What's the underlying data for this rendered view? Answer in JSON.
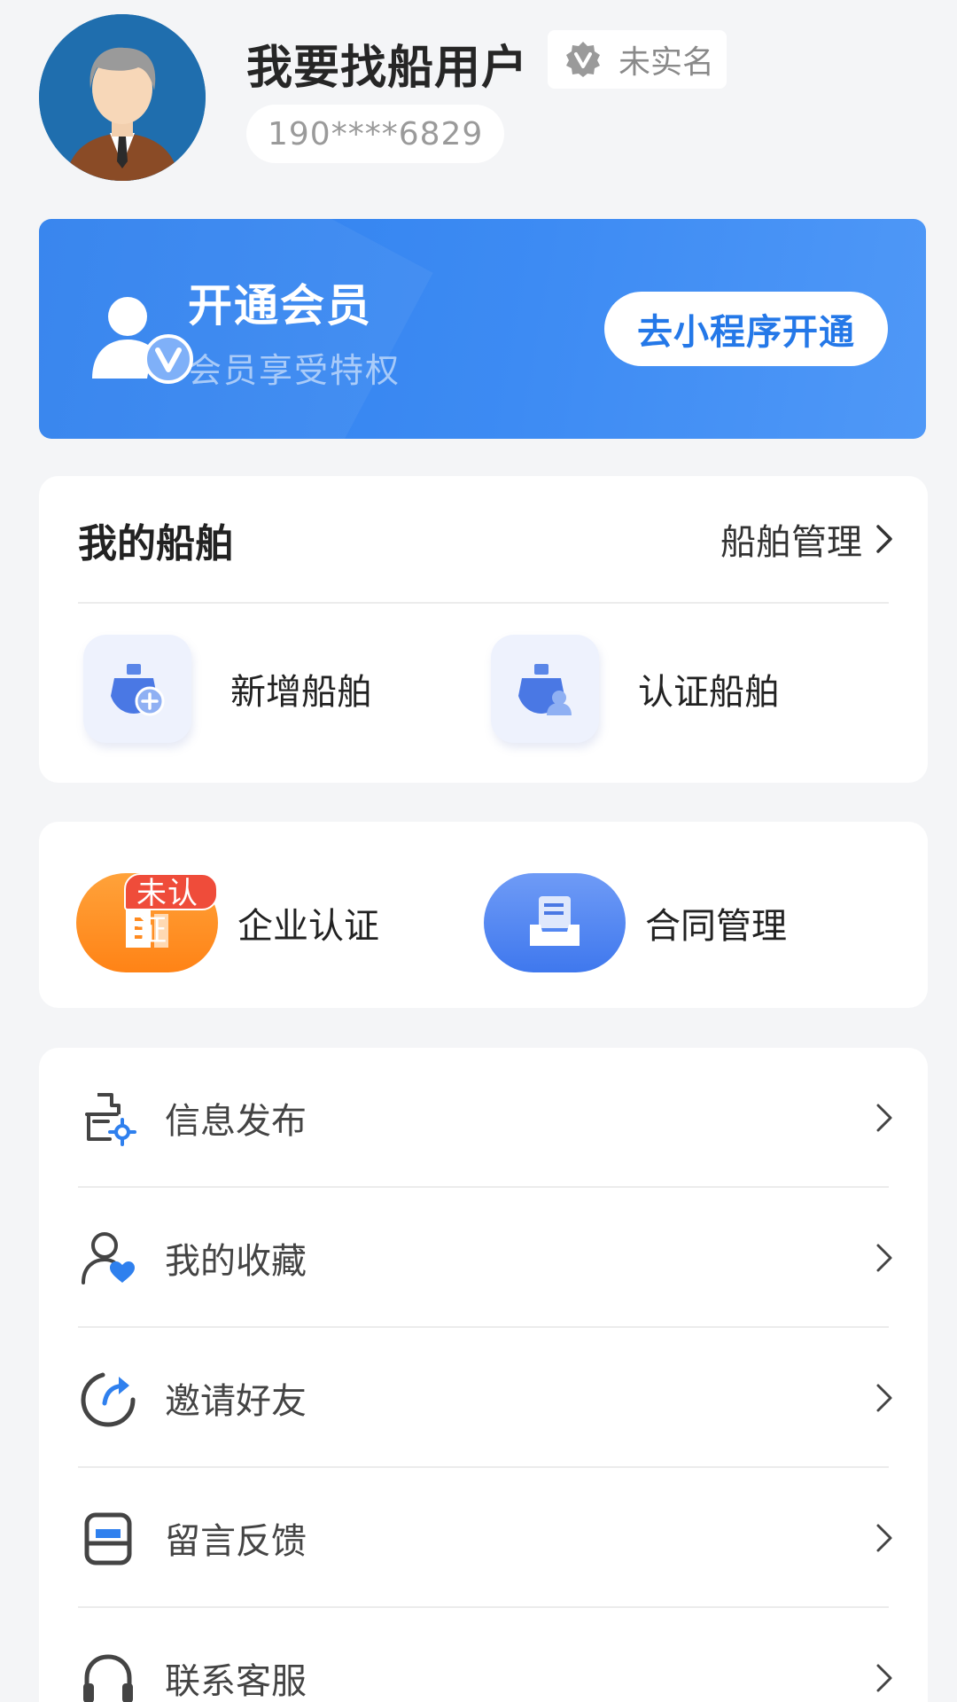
{
  "profile": {
    "username": "我要找船用户",
    "verify_status": "未实名",
    "phone": "190****6829"
  },
  "member": {
    "title": "开通会员",
    "subtitle": "会员享受特权",
    "button": "去小程序开通"
  },
  "my_ships": {
    "title": "我的船舶",
    "manage_label": "船舶管理",
    "actions": [
      {
        "label": "新增船舶",
        "icon": "ship-add-icon"
      },
      {
        "label": "认证船舶",
        "icon": "ship-user-icon"
      }
    ]
  },
  "business": {
    "items": [
      {
        "label": "企业认证",
        "icon": "building-icon",
        "tag": "未认证"
      },
      {
        "label": "合同管理",
        "icon": "contract-icon"
      }
    ]
  },
  "menu": {
    "items": [
      {
        "label": "信息发布",
        "icon": "publish-icon"
      },
      {
        "label": "我的收藏",
        "icon": "favorite-user-icon"
      },
      {
        "label": "邀请好友",
        "icon": "invite-refresh-icon"
      },
      {
        "label": "留言反馈",
        "icon": "feedback-icon"
      },
      {
        "label": "联系客服",
        "icon": "headset-icon"
      }
    ]
  },
  "colors": {
    "accent": "#2f80ee",
    "button_text": "#2478e8",
    "orange": "#ff8a1f",
    "badge_red": "#ef4c3a",
    "background": "#f4f5f7"
  }
}
